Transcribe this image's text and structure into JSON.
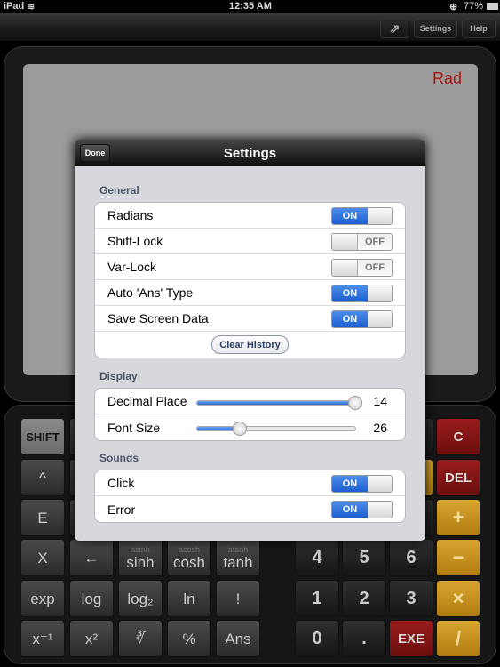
{
  "status": {
    "device": "iPad",
    "time": "12:35 AM",
    "battery": "77%"
  },
  "toolbar": {
    "share_icon": "share-icon",
    "settings": "Settings",
    "help": "Help"
  },
  "screen": {
    "mode": "Rad"
  },
  "keys": {
    "left": [
      [
        {
          "t": "SHIFT",
          "c": "shift"
        },
        {
          "t": ""
        },
        {
          "t": ""
        },
        {
          "t": ""
        },
        {
          "t": ""
        }
      ],
      [
        {
          "t": "^"
        },
        {
          "t": ""
        },
        {
          "t": ""
        },
        {
          "t": ""
        },
        {
          "t": ""
        }
      ],
      [
        {
          "t": "E"
        },
        {
          "t": ""
        },
        {
          "t": ""
        },
        {
          "t": ""
        },
        {
          "t": ""
        }
      ],
      [
        {
          "t": "X"
        },
        {
          "t": "←"
        },
        {
          "t": "sinh",
          "s": "asinh"
        },
        {
          "t": "cosh",
          "s": "acosh"
        },
        {
          "t": "tanh",
          "s": "atanh"
        }
      ],
      [
        {
          "t": "exp"
        },
        {
          "t": "log"
        },
        {
          "t": "log₂"
        },
        {
          "t": "ln"
        },
        {
          "t": "!"
        }
      ],
      [
        {
          "t": "x⁻¹"
        },
        {
          "t": "x²"
        },
        {
          "t": "∛"
        },
        {
          "t": "%"
        },
        {
          "t": "Ans"
        }
      ]
    ],
    "right": [
      [
        {
          "t": "",
          "c": "num"
        },
        {
          "t": "",
          "c": "num"
        },
        {
          "t": "",
          "c": "num"
        },
        {
          "t": "C",
          "c": "red"
        }
      ],
      [
        {
          "t": "",
          "c": "num"
        },
        {
          "t": "",
          "c": "num"
        },
        {
          "t": "",
          "c": "yel"
        },
        {
          "t": "DEL",
          "c": "red"
        }
      ],
      [
        {
          "t": "",
          "c": "num"
        },
        {
          "t": "",
          "c": "num"
        },
        {
          "t": "",
          "c": "num"
        },
        {
          "t": "+",
          "c": "yel"
        }
      ],
      [
        {
          "t": "4",
          "c": "num"
        },
        {
          "t": "5",
          "c": "num"
        },
        {
          "t": "6",
          "c": "num"
        },
        {
          "t": "−",
          "c": "yel"
        }
      ],
      [
        {
          "t": "1",
          "c": "num"
        },
        {
          "t": "2",
          "c": "num"
        },
        {
          "t": "3",
          "c": "num"
        },
        {
          "t": "×",
          "c": "yel"
        }
      ],
      [
        {
          "t": "0",
          "c": "num"
        },
        {
          "t": ".",
          "c": "num"
        },
        {
          "t": "EXE",
          "c": "red"
        },
        {
          "t": "/",
          "c": "yel"
        }
      ]
    ]
  },
  "settings": {
    "title": "Settings",
    "done": "Done",
    "general": {
      "header": "General",
      "rows": [
        {
          "label": "Radians",
          "on": true
        },
        {
          "label": "Shift-Lock",
          "on": false
        },
        {
          "label": "Var-Lock",
          "on": false
        },
        {
          "label": "Auto 'Ans' Type",
          "on": true
        },
        {
          "label": "Save Screen Data",
          "on": true
        }
      ],
      "clear": "Clear History"
    },
    "display": {
      "header": "Display",
      "rows": [
        {
          "label": "Decimal Place",
          "value": "14",
          "fraction": 1.0
        },
        {
          "label": "Font Size",
          "value": "26",
          "fraction": 0.27
        }
      ]
    },
    "sounds": {
      "header": "Sounds",
      "rows": [
        {
          "label": "Click",
          "on": true
        },
        {
          "label": "Error",
          "on": true
        }
      ]
    },
    "on_label": "ON",
    "off_label": "OFF"
  }
}
